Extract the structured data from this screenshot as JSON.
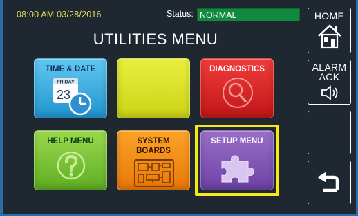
{
  "header": {
    "datetime": "08:00 AM 03/28/2016",
    "status_label": "Status:",
    "status_value": "NORMAL"
  },
  "title": "UTILITIES MENU",
  "tiles": [
    {
      "label": "TIME & DATE",
      "icon": "calendar-clock-icon",
      "calendar_day": "FRIDAY",
      "calendar_date": "23",
      "color": "#2195cf"
    },
    {
      "label": "",
      "icon": "",
      "color": "#dfe424"
    },
    {
      "label": "DIAGNOSTICS",
      "icon": "magnifier-icon",
      "color": "#d8201f"
    },
    {
      "label": "HELP MENU",
      "icon": "question-icon",
      "color": "#7cc23a"
    },
    {
      "label": "SYSTEM\nBOARDS",
      "label_line1": "SYSTEM",
      "label_line2": "BOARDS",
      "icon": "circuit-board-icon",
      "color": "#f18e16"
    },
    {
      "label": "SETUP MENU",
      "icon": "puzzle-piece-icon",
      "color": "#8457b8",
      "selected": true
    }
  ],
  "sidebar": {
    "home_label": "HOME",
    "alarm_label_line1": "ALARM",
    "alarm_label_line2": "ACK",
    "back_icon": "back-arrow-icon"
  },
  "colors": {
    "background": "#1f2731",
    "frame": "#2a6ea8",
    "status_ok": "#128a3e",
    "selection": "#f4ea1a",
    "clock_text": "#e8dc5a"
  }
}
